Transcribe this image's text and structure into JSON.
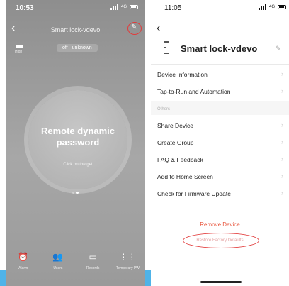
{
  "left_phone": {
    "status_time": "10:53",
    "network": "4G",
    "title": "Smart lock-vdevo",
    "battery_label": "High",
    "state_off": "off",
    "state_unknown": "unknown",
    "password_title": "Remote dynamic password",
    "password_hint": "Click on the get",
    "tabs": [
      {
        "label": "Alarm",
        "icon": "alarm-icon",
        "glyph": "⏰"
      },
      {
        "label": "Users",
        "icon": "users-icon",
        "glyph": "👥"
      },
      {
        "label": "Records",
        "icon": "calendar-icon",
        "glyph": "▭"
      },
      {
        "label": "Temporary PW",
        "icon": "keypad-icon",
        "glyph": "⋮⋮"
      }
    ]
  },
  "right_phone": {
    "status_time": "11:05",
    "network": "4G",
    "device_name": "Smart lock-vdevo",
    "menu_top": [
      {
        "label": "Device Information"
      },
      {
        "label": "Tap-to-Run and Automation"
      }
    ],
    "section_label": "Others",
    "menu_others": [
      {
        "label": "Share Device"
      },
      {
        "label": "Create Group"
      },
      {
        "label": "FAQ & Feedback"
      },
      {
        "label": "Add to Home Screen"
      },
      {
        "label": "Check for Firmware Update"
      }
    ],
    "remove_label": "Remove Device",
    "restore_label": "Restore Factory Defaults"
  },
  "colors": {
    "highlight_ring": "#e23b3b",
    "remove_text": "#e8553c",
    "bottom_strip": "#4fb3e8"
  }
}
